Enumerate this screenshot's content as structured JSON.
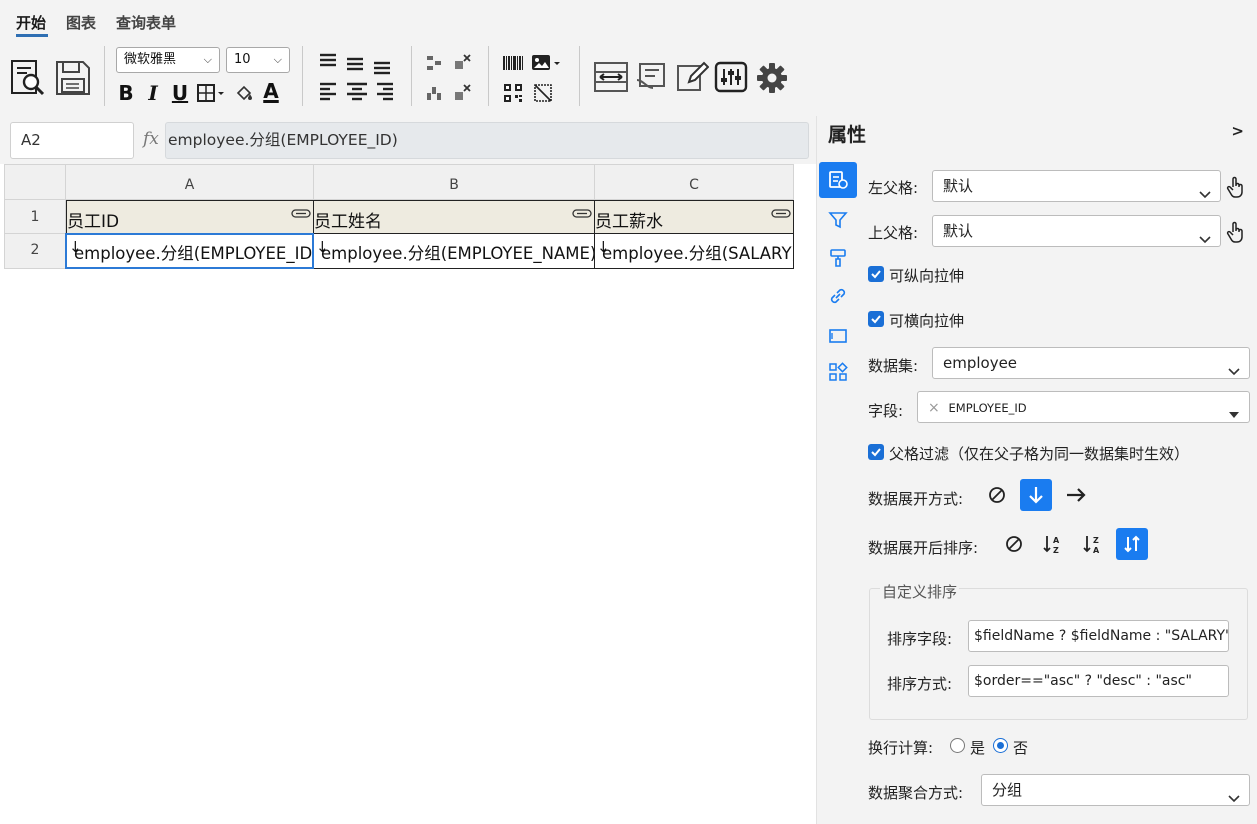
{
  "tabs": [
    {
      "label": "开始",
      "active": true
    },
    {
      "label": "图表",
      "active": false
    },
    {
      "label": "查询表单",
      "active": false
    }
  ],
  "toolbar": {
    "font_family": "微软雅黑",
    "font_size": "10",
    "bold_label": "B",
    "italic_label": "I",
    "underline_label": "U",
    "font_color_label": "A"
  },
  "formula_bar": {
    "cell_ref": "A2",
    "fx_label": "fx",
    "formula": "employee.分组(EMPLOYEE_ID)"
  },
  "grid": {
    "columns": [
      "A",
      "B",
      "C"
    ],
    "rows": [
      "1",
      "2"
    ],
    "header_cells": [
      "员工ID",
      "员工姓名",
      "员工薪水"
    ],
    "data_cells": [
      "employee.分组(EMPLOYEE_ID)",
      "employee.分组(EMPLOYEE_NAME)",
      "employee.分组(SALARY)"
    ],
    "expand_arrow": "↓",
    "selected_cell": "A2"
  },
  "panel": {
    "title": "属性",
    "collapse_label": ">",
    "left_parent_label": "左父格:",
    "left_parent_value": "默认",
    "top_parent_label": "上父格:",
    "top_parent_value": "默认",
    "vertical_stretch_label": "可纵向拉伸",
    "horizontal_stretch_label": "可横向拉伸",
    "dataset_label": "数据集:",
    "dataset_value": "employee",
    "field_label": "字段:",
    "field_tag": "EMPLOYEE_ID",
    "field_tag_remove": "×",
    "parent_filter_label": "父格过滤（仅在父子格为同一数据集时生效）",
    "expand_mode_label": "数据展开方式:",
    "expand_sort_label": "数据展开后排序:",
    "custom_sort_legend": "自定义排序",
    "sort_field_label": "排序字段:",
    "sort_field_value": "$fieldName ? $fieldName : \"SALARY\"",
    "sort_order_label": "排序方式:",
    "sort_order_value": "$order==\"asc\" ? \"desc\" : \"asc\"",
    "wrap_calc_label": "换行计算:",
    "wrap_yes": "是",
    "wrap_no": "否",
    "wrap_selected": "否",
    "aggregate_label": "数据聚合方式:",
    "aggregate_value": "分组"
  },
  "colors": {
    "accent": "#1a7cf0",
    "selection": "#2c7ad6",
    "header_fill": "#eeebe0"
  }
}
